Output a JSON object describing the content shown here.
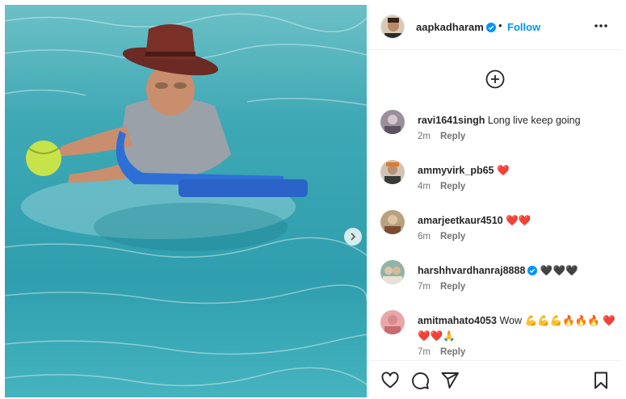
{
  "post": {
    "username": "aapkadharam",
    "verified": true,
    "separator": "•",
    "follow_label": "Follow"
  },
  "comments": [
    {
      "user": "ravi1641singh",
      "text": "Long live keep going",
      "time": "2m",
      "reply": "Reply"
    },
    {
      "user": "ammyvirk_pb65",
      "text": "❤️",
      "time": "4m",
      "reply": "Reply"
    },
    {
      "user": "amarjeetkaur4510",
      "text": "❤️❤️",
      "time": "6m",
      "reply": "Reply"
    },
    {
      "user": "harshhvardhanraj8888",
      "text": "🖤🖤🖤",
      "time": "7m",
      "reply": "Reply",
      "verified": true
    },
    {
      "user": "amitmahato4053",
      "text": "Wow 💪💪💪🔥🔥🔥 ❤️❤️❤️🙏",
      "time": "7m",
      "reply": "Reply"
    }
  ],
  "colors": {
    "link": "#0095f6",
    "verified": "#0095f6",
    "muted": "#737373",
    "water": "#33a3b2"
  },
  "icons": [
    "verified-badge-icon",
    "more-options-icon",
    "add-circle-icon",
    "chevron-right-icon",
    "heart-icon",
    "comment-icon",
    "share-icon",
    "bookmark-icon"
  ]
}
